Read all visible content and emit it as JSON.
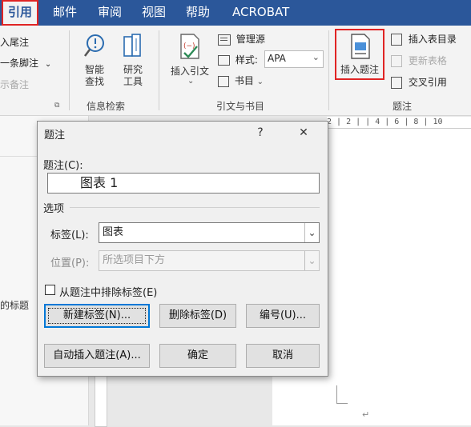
{
  "tabs": [
    {
      "label": "引用",
      "active": true
    },
    {
      "label": "邮件"
    },
    {
      "label": "审阅"
    },
    {
      "label": "视图"
    },
    {
      "label": "帮助"
    },
    {
      "label": "ACROBAT"
    }
  ],
  "ribbon": {
    "footnotes": {
      "insert_endnote": "入尾注",
      "next_footnote": "一条脚注",
      "show_notes": "示备注"
    },
    "research": {
      "smart_lookup": "智能\n查找",
      "researcher": "研究\n工具",
      "group_label": "信息检索"
    },
    "citations": {
      "insert_citation": "插入引文",
      "manage_sources": "管理源",
      "style_label": "样式:",
      "style_value": "APA",
      "bibliography": "书目",
      "group_label": "引文与书目"
    },
    "captions": {
      "insert_caption": "插入题注",
      "insert_table_of_figures": "插入表目录",
      "update_table": "更新表格",
      "cross_reference": "交叉引用",
      "group_label": "题注"
    }
  },
  "doc": {
    "left_pane_text": "的标题",
    "ruler_text": "2 | 2 |  | 4 | 6 | 8 | 10"
  },
  "dialog": {
    "title": "题注",
    "help": "?",
    "close": "✕",
    "caption_label": "题注(C):",
    "caption_value": "图表 1",
    "options_label": "选项",
    "label_label": "标签(L):",
    "label_value": "图表",
    "position_label": "位置(P):",
    "position_value": "所选项目下方",
    "exclude_label": "从题注中排除标签(E)",
    "new_label": "新建标签(N)...",
    "delete_label": "删除标签(D)",
    "numbering": "编号(U)...",
    "auto_caption": "自动插入题注(A)...",
    "ok": "确定",
    "cancel": "取消"
  },
  "colors": {
    "brand": "#2b579a",
    "highlight": "#e02424",
    "focus": "#0078d7"
  }
}
